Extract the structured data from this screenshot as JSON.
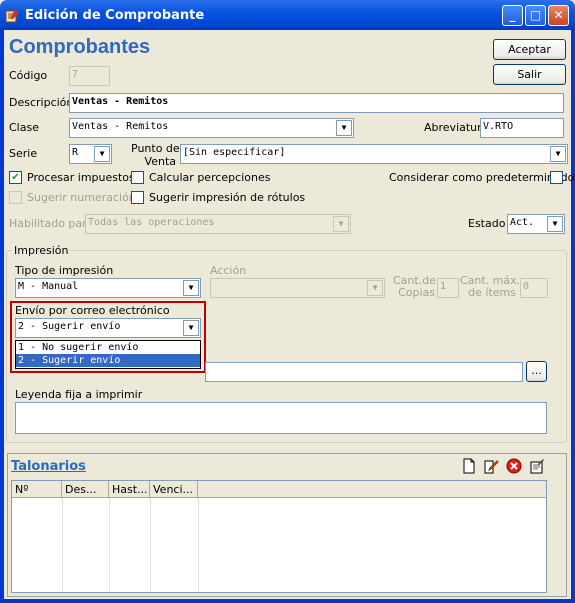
{
  "window": {
    "title": "Edición de Comprobante",
    "minimize": "_",
    "maximize": "□",
    "close": "✕",
    "app_icon": "app-icon"
  },
  "heading": "Comprobantes",
  "buttons": {
    "accept": "Aceptar",
    "exit": "Salir",
    "browse": "..."
  },
  "codigo": {
    "label": "Código",
    "value": "7"
  },
  "descripcion": {
    "label": "Descripción",
    "value": "Ventas - Remitos"
  },
  "clase": {
    "label": "Clase",
    "value": "Ventas - Remitos"
  },
  "abreviatura": {
    "label": "Abreviatura",
    "value": "V.RTO"
  },
  "serie": {
    "label": "Serie",
    "value": "R"
  },
  "punto_venta": {
    "label_line1": "Punto de",
    "label_line2": "Venta",
    "value": "[Sin especificar]"
  },
  "checks": {
    "procesar_impuestos": {
      "label": "Procesar impuestos",
      "checked": true,
      "mark": "✔"
    },
    "calcular_percepciones": {
      "label": "Calcular percepciones",
      "checked": false
    },
    "considerar_predeterminado": {
      "label": "Considerar como predeterminado",
      "checked": false
    },
    "sugerir_numeracion": {
      "label": "Sugerir numeración",
      "checked": false
    },
    "sugerir_rotulos": {
      "label": "Sugerir impresión de rótulos",
      "checked": false
    }
  },
  "habilitado": {
    "label": "Habilitado para",
    "value": "Todas las operaciones"
  },
  "estado": {
    "label": "Estado",
    "value": "Act."
  },
  "impresion": {
    "group_label": "Impresión",
    "tipo": {
      "label": "Tipo de impresión",
      "value": "M - Manual"
    },
    "accion": {
      "label": "Acción",
      "value": ""
    },
    "cant_copias": {
      "label_line1": "Cant.de",
      "label_line2": "Copias",
      "value": "1"
    },
    "cant_max_items": {
      "label_line1": "Cant. máx.",
      "label_line2": "de ítems",
      "value": "0"
    },
    "envio": {
      "label": "Envío por correo electrónico",
      "value": "2 - Sugerir envío",
      "options": [
        "1 - No sugerir envío",
        "2 - Sugerir envío"
      ]
    },
    "leyenda": {
      "label": "Leyenda fija a imprimir",
      "value": ""
    }
  },
  "talonarios": {
    "title": "Talonarios",
    "columns": [
      "Nº",
      "Des...",
      "Hast...",
      "Venci..."
    ],
    "toolbar": [
      "new-doc-icon",
      "edit-doc-icon",
      "delete-icon",
      "properties-icon"
    ]
  },
  "colors": {
    "titlebar": "#0A54E0",
    "heading": "#2E6AC1",
    "highlight": "#316AC5",
    "red_box": "#C00000"
  }
}
